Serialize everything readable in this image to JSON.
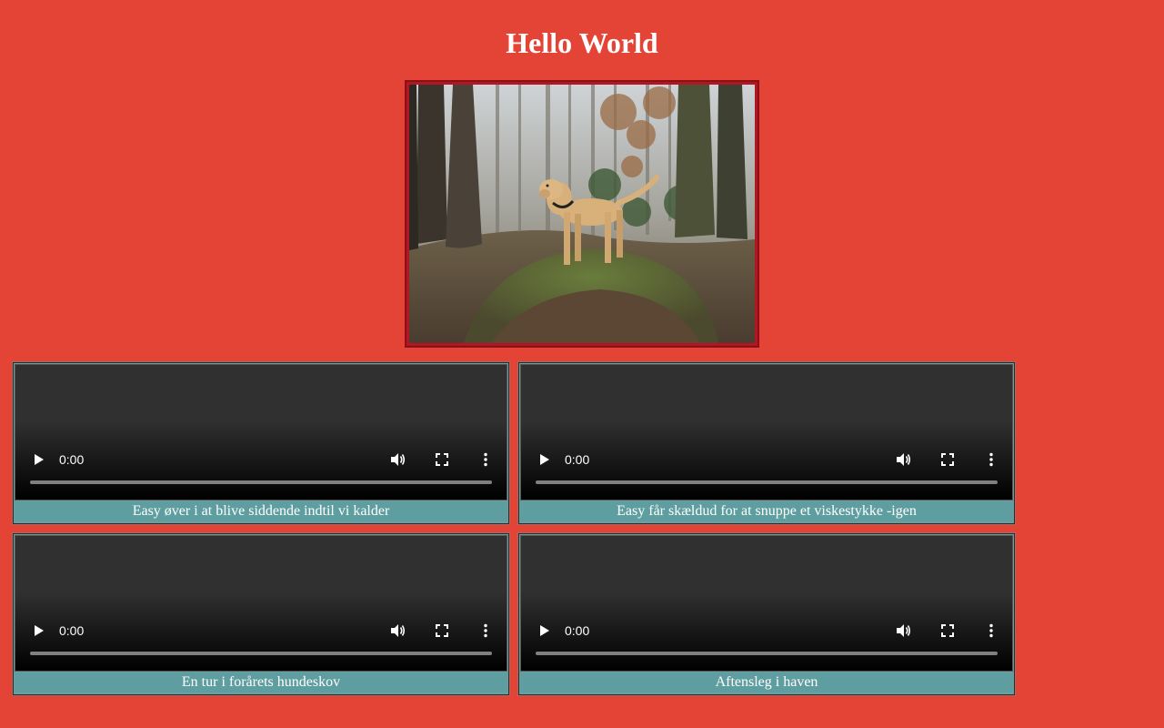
{
  "page": {
    "title": "Hello World"
  },
  "hero_image": {
    "alt_semantic": "dog-in-forest-photo"
  },
  "videos": [
    {
      "time": "0:00",
      "caption": "Easy øver i at blive siddende indtil vi kalder"
    },
    {
      "time": "0:00",
      "caption": "Easy får skældud for at snuppe et viskestykke -igen"
    },
    {
      "time": "0:00",
      "caption": "En tur i forårets hundeskov"
    },
    {
      "time": "0:00",
      "caption": "Aftensleg i haven"
    }
  ],
  "colors": {
    "background": "#e44436",
    "caption_bg": "#5f9ea0",
    "hero_frame": "#b01722"
  }
}
